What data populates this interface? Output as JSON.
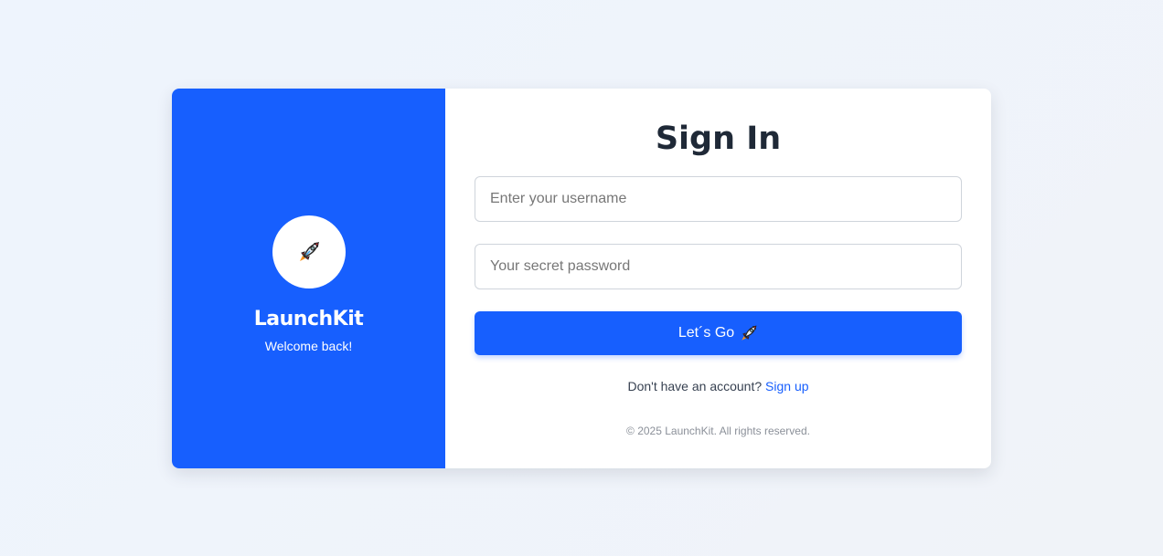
{
  "brand": {
    "name": "LaunchKit",
    "tagline": "Welcome back!",
    "logo_icon": "rocket-icon"
  },
  "form": {
    "title": "Sign In",
    "username_placeholder": "Enter your username",
    "password_placeholder": "Your secret password",
    "submit_label": "Let´s Go",
    "submit_icon": "rocket-icon",
    "signup_prompt": "Don't have an account?",
    "signup_link": "Sign up"
  },
  "footer": "© 2025 LaunchKit. All rights reserved.",
  "colors": {
    "primary": "#175ffe",
    "title": "#1f2937"
  }
}
